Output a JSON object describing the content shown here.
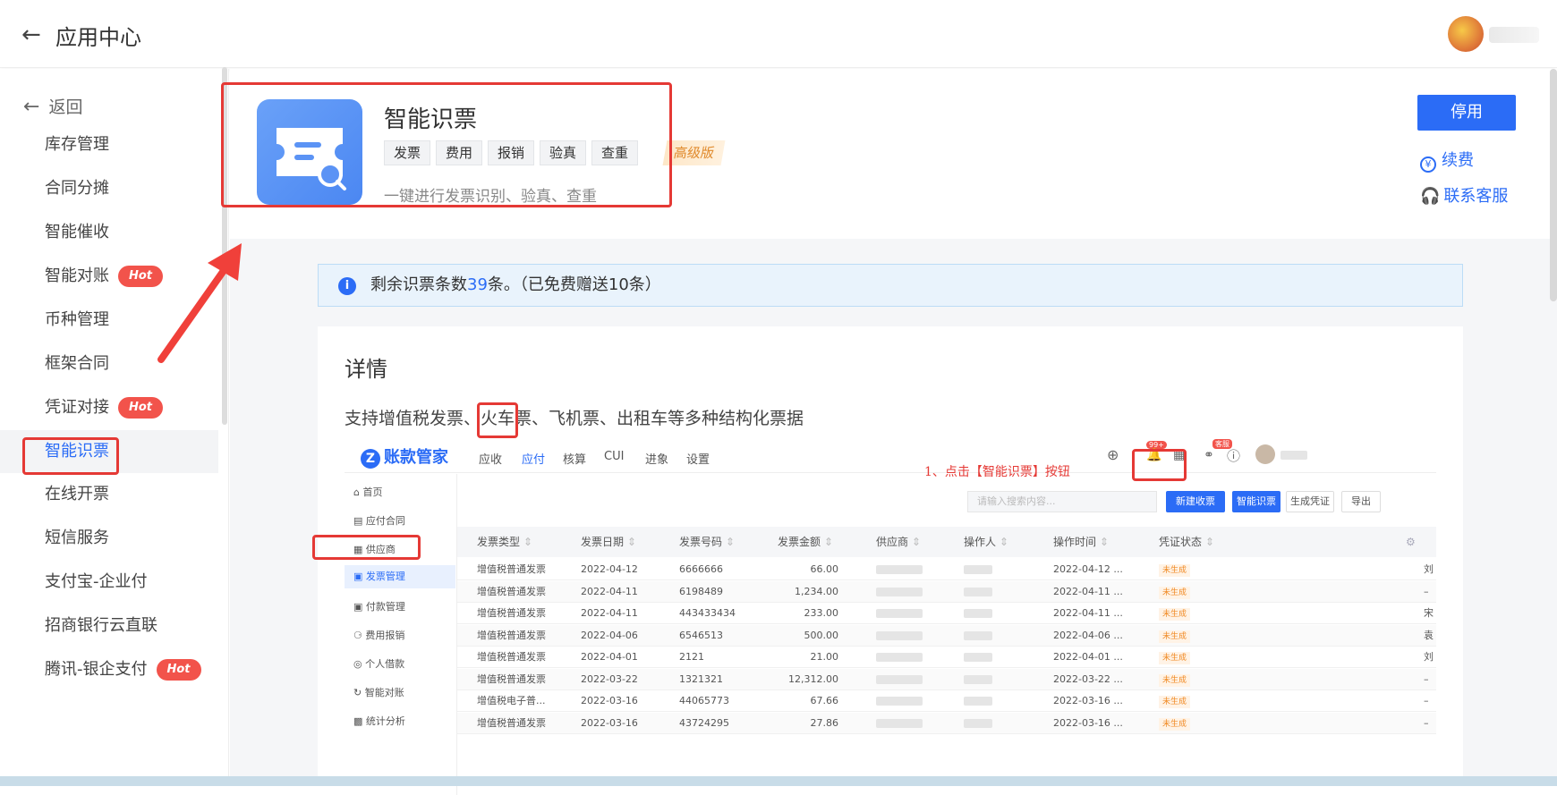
{
  "header": {
    "back_icon": "arrow-left-icon",
    "title": "应用中心"
  },
  "sidebar": {
    "back_label": "返回",
    "items": [
      {
        "label": "库存管理",
        "hot": ""
      },
      {
        "label": "合同分摊",
        "hot": ""
      },
      {
        "label": "智能催收",
        "hot": ""
      },
      {
        "label": "智能对账",
        "hot": "Hot"
      },
      {
        "label": "币种管理",
        "hot": ""
      },
      {
        "label": "框架合同",
        "hot": ""
      },
      {
        "label": "凭证对接",
        "hot": "Hot"
      },
      {
        "label": "智能识票",
        "hot": "",
        "active": true
      },
      {
        "label": "在线开票",
        "hot": ""
      },
      {
        "label": "短信服务",
        "hot": ""
      },
      {
        "label": "支付宝-企业付",
        "hot": ""
      },
      {
        "label": "招商银行云直联",
        "hot": ""
      },
      {
        "label": "腾讯-银企支付",
        "hot": "Hot"
      }
    ]
  },
  "app": {
    "name": "智能识票",
    "tags": [
      "发票",
      "费用",
      "报销",
      "验真",
      "查重"
    ],
    "edition": "高级版",
    "description": "一键进行发票识别、验真、查重",
    "stop_label": "停用",
    "renew_label": "续费",
    "support_label": "联系客服"
  },
  "notice": {
    "prefix": "剩余识票条数",
    "count": "39",
    "suffix": "条。（已免费赠送10条）"
  },
  "detail": {
    "title": "详情",
    "description": "支持增值税发票、火车票、飞机票、出租车等多种结构化票据"
  },
  "screenshot": {
    "logo": "账款管家",
    "nav": [
      "应收",
      "应付",
      "核算",
      "CUI",
      "进象",
      "设置"
    ],
    "badge_99": "99+",
    "badge_service": "客服",
    "annotation": "1、点击【智能识票】按钮",
    "search_placeholder": "请输入搜索内容...",
    "buttons": [
      "新建收票",
      "智能识票",
      "生成凭证",
      "导出"
    ],
    "side_items": [
      "首页",
      "应付合同",
      "供应商",
      "发票管理",
      "付款管理",
      "费用报销",
      "个人借款",
      "智能对账",
      "统计分析"
    ],
    "columns": [
      "发票类型",
      "发票日期",
      "发票号码",
      "发票金额",
      "供应商",
      "操作人",
      "操作时间",
      "凭证状态"
    ],
    "rows": [
      {
        "type": "增值税普通发票",
        "date": "2022-04-12",
        "no": "6666666",
        "amount": "66.00",
        "time": "2022-04-12 ...",
        "status": "未生成",
        "extra": "刘"
      },
      {
        "type": "增值税普通发票",
        "date": "2022-04-11",
        "no": "6198489",
        "amount": "1,234.00",
        "time": "2022-04-11 ...",
        "status": "未生成",
        "extra": "–"
      },
      {
        "type": "增值税普通发票",
        "date": "2022-04-11",
        "no": "443433434",
        "amount": "233.00",
        "time": "2022-04-11 ...",
        "status": "未生成",
        "extra": "宋"
      },
      {
        "type": "增值税普通发票",
        "date": "2022-04-06",
        "no": "6546513",
        "amount": "500.00",
        "time": "2022-04-06 ...",
        "status": "未生成",
        "extra": "袁"
      },
      {
        "type": "增值税普通发票",
        "date": "2022-04-01",
        "no": "2121",
        "amount": "21.00",
        "time": "2022-04-01 ...",
        "status": "未生成",
        "extra": "刘"
      },
      {
        "type": "增值税普通发票",
        "date": "2022-03-22",
        "no": "1321321",
        "amount": "12,312.00",
        "time": "2022-03-22 ...",
        "status": "未生成",
        "extra": "–"
      },
      {
        "type": "增值税电子普...",
        "date": "2022-03-16",
        "no": "44065773",
        "amount": "67.66",
        "time": "2022-03-16 ...",
        "status": "未生成",
        "extra": "–"
      },
      {
        "type": "增值税普通发票",
        "date": "2022-03-16",
        "no": "43724295",
        "amount": "27.86",
        "time": "2022-03-16 ...",
        "status": "未生成",
        "extra": "–"
      }
    ]
  },
  "colors": {
    "accent": "#2b6cf6",
    "highlight": "#e53935",
    "hot": "#f2534b"
  }
}
